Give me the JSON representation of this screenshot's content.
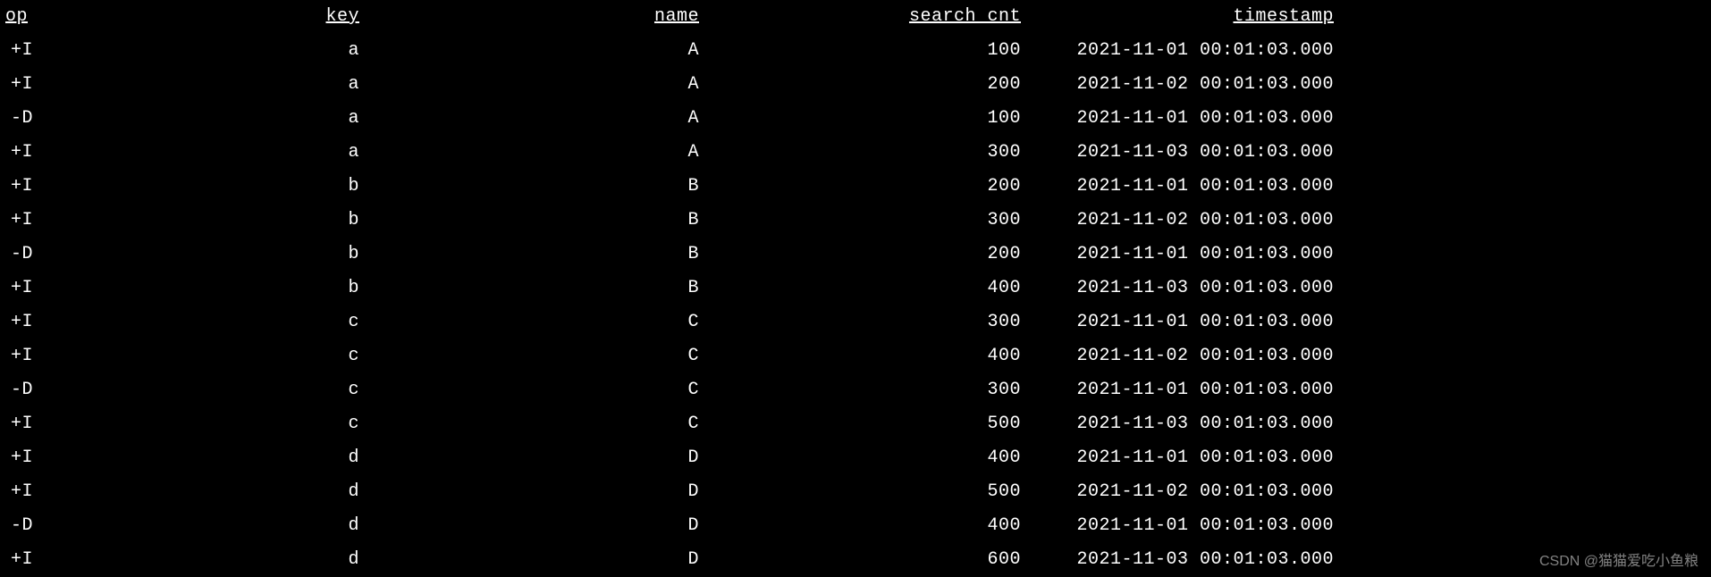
{
  "columns": {
    "op": "op",
    "key": "key",
    "name": "name",
    "search_cnt": "search_cnt",
    "timestamp": "timestamp"
  },
  "rows": [
    {
      "op": "+I",
      "key": "a",
      "name": "A",
      "search_cnt": "100",
      "timestamp": "2021-11-01 00:01:03.000"
    },
    {
      "op": "+I",
      "key": "a",
      "name": "A",
      "search_cnt": "200",
      "timestamp": "2021-11-02 00:01:03.000"
    },
    {
      "op": "-D",
      "key": "a",
      "name": "A",
      "search_cnt": "100",
      "timestamp": "2021-11-01 00:01:03.000"
    },
    {
      "op": "+I",
      "key": "a",
      "name": "A",
      "search_cnt": "300",
      "timestamp": "2021-11-03 00:01:03.000"
    },
    {
      "op": "+I",
      "key": "b",
      "name": "B",
      "search_cnt": "200",
      "timestamp": "2021-11-01 00:01:03.000"
    },
    {
      "op": "+I",
      "key": "b",
      "name": "B",
      "search_cnt": "300",
      "timestamp": "2021-11-02 00:01:03.000"
    },
    {
      "op": "-D",
      "key": "b",
      "name": "B",
      "search_cnt": "200",
      "timestamp": "2021-11-01 00:01:03.000"
    },
    {
      "op": "+I",
      "key": "b",
      "name": "B",
      "search_cnt": "400",
      "timestamp": "2021-11-03 00:01:03.000"
    },
    {
      "op": "+I",
      "key": "c",
      "name": "C",
      "search_cnt": "300",
      "timestamp": "2021-11-01 00:01:03.000"
    },
    {
      "op": "+I",
      "key": "c",
      "name": "C",
      "search_cnt": "400",
      "timestamp": "2021-11-02 00:01:03.000"
    },
    {
      "op": "-D",
      "key": "c",
      "name": "C",
      "search_cnt": "300",
      "timestamp": "2021-11-01 00:01:03.000"
    },
    {
      "op": "+I",
      "key": "c",
      "name": "C",
      "search_cnt": "500",
      "timestamp": "2021-11-03 00:01:03.000"
    },
    {
      "op": "+I",
      "key": "d",
      "name": "D",
      "search_cnt": "400",
      "timestamp": "2021-11-01 00:01:03.000"
    },
    {
      "op": "+I",
      "key": "d",
      "name": "D",
      "search_cnt": "500",
      "timestamp": "2021-11-02 00:01:03.000"
    },
    {
      "op": "-D",
      "key": "d",
      "name": "D",
      "search_cnt": "400",
      "timestamp": "2021-11-01 00:01:03.000"
    },
    {
      "op": "+I",
      "key": "d",
      "name": "D",
      "search_cnt": "600",
      "timestamp": "2021-11-03 00:01:03.000"
    }
  ],
  "watermark": "CSDN @猫猫爱吃小鱼粮"
}
